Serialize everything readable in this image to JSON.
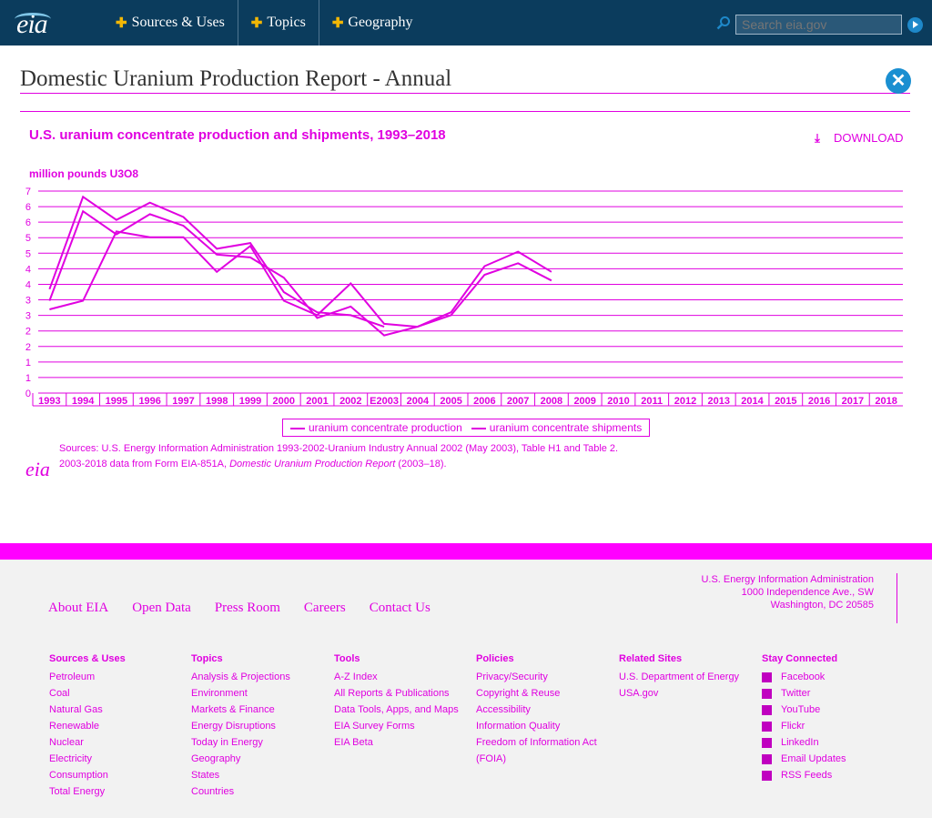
{
  "header": {
    "logo": "eia",
    "nav": [
      "Sources & Uses",
      "Topics",
      "Geography"
    ],
    "search_placeholder": "Search eia.gov"
  },
  "page": {
    "title": "Domestic Uranium Production Report - Annual"
  },
  "chart": {
    "title": "U.S. uranium concentrate production and shipments, 1993–2018",
    "units": "million pounds U3O8",
    "download_label": "DOWNLOAD"
  },
  "chart_data": {
    "type": "line",
    "title": "U.S. uranium concentrate production and shipments, 1993–2018",
    "ylabel": "million pounds U3O8",
    "xlabel": "",
    "x": [
      "1993",
      "1994",
      "1995",
      "1996",
      "1997",
      "1998",
      "1999",
      "2000",
      "2001",
      "2002",
      "E2003",
      "2004",
      "2005",
      "2006",
      "2007",
      "2008",
      "2009",
      "2010",
      "2011",
      "2012",
      "2013",
      "2014",
      "2015",
      "2016",
      "2017",
      "2018"
    ],
    "y_ticks": [
      "0",
      "1",
      "1",
      "2",
      "2",
      "3",
      "3",
      "4",
      "4",
      "5",
      "5",
      "6",
      "6",
      "7"
    ],
    "ylim": [
      0,
      7
    ],
    "series": [
      {
        "name": "uranium concentrate production",
        "values": [
          3.2,
          6.3,
          5.5,
          6.2,
          5.8,
          4.8,
          4.7,
          4.0,
          2.6,
          3.0,
          2.0,
          2.3,
          2.7,
          4.1,
          4.5,
          3.9,
          null,
          null,
          null,
          null,
          null,
          null,
          null,
          null,
          null,
          null
        ]
      },
      {
        "name": "uranium concentrate shipments",
        "values": [
          2.9,
          3.2,
          5.6,
          5.4,
          5.4,
          4.2,
          5.1,
          3.2,
          2.7,
          3.8,
          2.4,
          2.3,
          2.8,
          4.4,
          4.9,
          4.2,
          null,
          null,
          null,
          null,
          null,
          null,
          null,
          null,
          null,
          null
        ]
      },
      {
        "name": "uranium concentrate production",
        "values": [
          3.6,
          6.8,
          6.0,
          6.6,
          6.1,
          5.0,
          5.2,
          3.5,
          2.8,
          2.7,
          2.3,
          null,
          null,
          null,
          null,
          null,
          null,
          null,
          null,
          null,
          null,
          null,
          null,
          null,
          null,
          null
        ]
      }
    ],
    "grid": true,
    "legend": "bottom-center"
  },
  "legend": {
    "production": "uranium concentrate production",
    "shipments": "uranium concentrate shipments"
  },
  "sources": {
    "line1": "Sources: U.S. Energy Information Administration 1993-2002-Uranium Industry Annual 2002 (May 2003), Table H1 and Table 2.",
    "line2_prefix": "2003-2018 data from Form EIA-851A, ",
    "line2_title": "Domestic Uranium Production Report",
    "line2_suffix": " (2003–18)."
  },
  "footer": {
    "links": [
      "About EIA",
      "Open Data",
      "Press Room",
      "Careers",
      "Contact Us"
    ],
    "address": [
      "U.S. Energy Information Administration",
      "1000 Independence Ave., SW",
      "Washington, DC 20585"
    ],
    "columns": [
      {
        "head": "Sources & Uses",
        "items": [
          "Petroleum",
          "Coal",
          "Natural Gas",
          "Renewable",
          "Nuclear",
          "Electricity",
          "Consumption",
          "Total Energy"
        ]
      },
      {
        "head": "Topics",
        "items": [
          "Analysis & Projections",
          "Environment",
          "Markets & Finance",
          "Energy Disruptions",
          "Today in Energy",
          "Geography",
          "States",
          "Countries"
        ]
      },
      {
        "head": "Tools",
        "items": [
          "A-Z Index",
          "All Reports & Publications",
          "Data Tools, Apps, and Maps",
          "EIA Survey Forms",
          "EIA Beta"
        ]
      },
      {
        "head": "Policies",
        "items": [
          "Privacy/Security",
          "Copyright & Reuse",
          "Accessibility",
          "Information Quality",
          "Freedom of Information Act (FOIA)"
        ]
      },
      {
        "head": "Related Sites",
        "items": [
          "U.S. Department of Energy",
          "USA.gov"
        ]
      },
      {
        "head": "Stay Connected",
        "items": [
          "Facebook",
          "Twitter",
          "YouTube",
          "Flickr",
          "LinkedIn",
          "Email Updates",
          "RSS Feeds"
        ]
      }
    ]
  }
}
